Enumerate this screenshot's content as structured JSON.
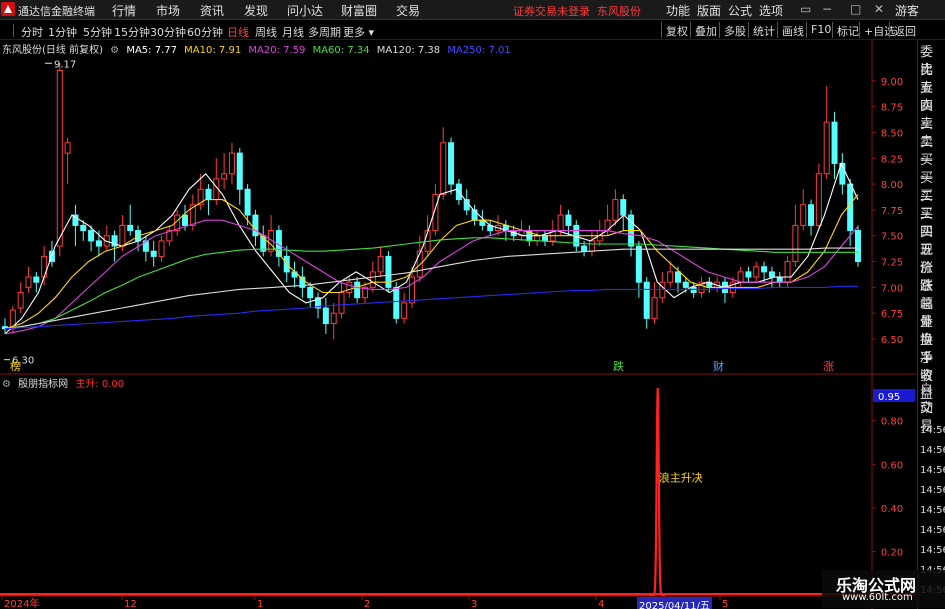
{
  "menubar": {
    "app_title": "通达信金融终端",
    "menus": [
      "行情",
      "市场",
      "资讯",
      "发现",
      "问小达",
      "财富圈",
      "交易"
    ],
    "alert": "证券交易未登录",
    "stock": "东风股份",
    "right_menus": [
      "功能",
      "版面",
      "公式",
      "选项"
    ],
    "guest": "游客"
  },
  "periodbar": {
    "periods": [
      "分时",
      "1分钟",
      "5分钟",
      "15分钟",
      "30分钟",
      "60分钟",
      "日线",
      "周线",
      "月线",
      "多周期",
      "更多"
    ],
    "active": "日线",
    "tools": [
      "复权",
      "叠加",
      "多股",
      "统计",
      "画线",
      "F10",
      "标记",
      "+自选",
      "返回"
    ]
  },
  "header": {
    "stock_name": "东风股份(日线 前复权)",
    "ma": [
      {
        "label": "MA5: 7.77",
        "color": "#ffffff"
      },
      {
        "label": "MA10: 7.91",
        "color": "#ffd700"
      },
      {
        "label": "MA20: 7.59",
        "color": "#e040e0"
      },
      {
        "label": "MA60: 7.34",
        "color": "#40e040"
      },
      {
        "label": "MA120: 7.38",
        "color": "#dddddd"
      },
      {
        "label": "MA250: 7.01",
        "color": "#4040ff"
      }
    ]
  },
  "indicator": {
    "name": "殷朋指标网",
    "series_label": "主升: 0.00",
    "current_value": "0.95",
    "annotation": "浪主升决",
    "y_ticks": [
      "0.80",
      "0.60",
      "0.40",
      "0.20"
    ]
  },
  "price_axis": {
    "ticks": [
      "9.00",
      "8.75",
      "8.50",
      "8.25",
      "8.00",
      "7.75",
      "7.50",
      "7.25",
      "7.00",
      "6.75",
      "6.50"
    ],
    "high_label": "9.17",
    "low_label": "6.30"
  },
  "markers": [
    "榜",
    "跌",
    "财",
    "涨"
  ],
  "time_axis": {
    "labels": [
      "2024年",
      "12",
      "1",
      "2",
      "3",
      "4",
      "5"
    ],
    "cursor_date": "2025/04/11/五"
  },
  "rightpanel": {
    "items": [
      "委比",
      "卖五",
      "卖四",
      "卖三",
      "卖二",
      "卖一",
      "买一",
      "买二",
      "买三",
      "买四",
      "买五",
      "现价",
      "涨跌",
      "涨幅",
      "总量",
      "外盘",
      "换手",
      "净资",
      "收益"
    ],
    "bottom_items": [
      "自动",
      "交易"
    ],
    "times": [
      "14:56",
      "14:56",
      "14:56",
      "14:56",
      "14:56",
      "14:56",
      "14:56",
      "14:56",
      "14:56"
    ]
  },
  "watermark": {
    "title": "乐淘公式网",
    "url": "www.60lt.com"
  },
  "chart_data": {
    "type": "candlestick",
    "ylim": [
      6.3,
      9.17
    ],
    "up_color": "#ff3b3b",
    "down_color": "#54ffff",
    "candles": [
      [
        6.62,
        6.6,
        6.7,
        6.55
      ],
      [
        6.6,
        6.78,
        6.82,
        6.56
      ],
      [
        6.8,
        6.95,
        7.05,
        6.75
      ],
      [
        7.0,
        7.1,
        7.2,
        6.95
      ],
      [
        7.1,
        7.05,
        7.15,
        6.95
      ],
      [
        7.1,
        7.3,
        7.4,
        7.02
      ],
      [
        7.35,
        7.25,
        7.45,
        7.2
      ],
      [
        7.4,
        9.1,
        9.17,
        7.3
      ],
      [
        8.3,
        8.4,
        8.45,
        8.0
      ],
      [
        7.7,
        7.6,
        7.8,
        7.4
      ],
      [
        7.6,
        7.55,
        7.65,
        7.45
      ],
      [
        7.55,
        7.45,
        7.6,
        7.35
      ],
      [
        7.45,
        7.4,
        7.55,
        7.3
      ],
      [
        7.4,
        7.5,
        7.6,
        7.35
      ],
      [
        7.5,
        7.4,
        7.55,
        7.25
      ],
      [
        7.4,
        7.6,
        7.7,
        7.35
      ],
      [
        7.6,
        7.55,
        7.8,
        7.5
      ],
      [
        7.55,
        7.45,
        7.6,
        7.35
      ],
      [
        7.45,
        7.35,
        7.5,
        7.25
      ],
      [
        7.35,
        7.3,
        7.45,
        7.2
      ],
      [
        7.3,
        7.45,
        7.5,
        7.25
      ],
      [
        7.45,
        7.55,
        7.6,
        7.4
      ],
      [
        7.55,
        7.7,
        7.75,
        7.5
      ],
      [
        7.7,
        7.6,
        7.8,
        7.55
      ],
      [
        7.6,
        7.8,
        7.9,
        7.55
      ],
      [
        7.8,
        7.95,
        8.1,
        7.75
      ],
      [
        7.95,
        7.85,
        8.0,
        7.7
      ],
      [
        7.85,
        8.05,
        8.25,
        7.8
      ],
      [
        8.05,
        8.1,
        8.3,
        7.95
      ],
      [
        8.1,
        8.3,
        8.4,
        8.0
      ],
      [
        8.3,
        7.95,
        8.35,
        7.8
      ],
      [
        7.95,
        7.7,
        8.0,
        7.6
      ],
      [
        7.7,
        7.5,
        7.75,
        7.4
      ],
      [
        7.5,
        7.35,
        7.6,
        7.3
      ],
      [
        7.35,
        7.55,
        7.7,
        7.3
      ],
      [
        7.55,
        7.3,
        7.6,
        7.2
      ],
      [
        7.3,
        7.15,
        7.4,
        7.05
      ],
      [
        7.15,
        7.1,
        7.25,
        7.0
      ],
      [
        7.1,
        7.0,
        7.2,
        6.9
      ],
      [
        7.0,
        6.9,
        7.05,
        6.8
      ],
      [
        6.9,
        6.8,
        6.95,
        6.7
      ],
      [
        6.8,
        6.65,
        6.9,
        6.55
      ],
      [
        6.65,
        6.75,
        6.85,
        6.5
      ],
      [
        6.75,
        6.95,
        7.05,
        6.7
      ],
      [
        6.95,
        7.05,
        7.1,
        6.9
      ],
      [
        7.05,
        6.9,
        7.1,
        6.85
      ],
      [
        6.9,
        7.0,
        7.05,
        6.85
      ],
      [
        7.0,
        7.15,
        7.25,
        6.95
      ],
      [
        7.15,
        7.3,
        7.4,
        7.1
      ],
      [
        7.3,
        7.0,
        7.35,
        6.95
      ],
      [
        7.0,
        6.7,
        7.05,
        6.65
      ],
      [
        6.7,
        6.85,
        6.95,
        6.65
      ],
      [
        6.85,
        7.1,
        7.2,
        6.8
      ],
      [
        7.1,
        7.35,
        7.5,
        7.05
      ],
      [
        7.35,
        7.55,
        7.7,
        7.3
      ],
      [
        7.55,
        7.9,
        8.0,
        7.5
      ],
      [
        7.9,
        8.4,
        8.55,
        7.85
      ],
      [
        8.4,
        8.0,
        8.45,
        7.9
      ],
      [
        8.0,
        7.85,
        8.05,
        7.8
      ],
      [
        7.85,
        7.75,
        7.95,
        7.7
      ],
      [
        7.75,
        7.65,
        7.8,
        7.6
      ],
      [
        7.65,
        7.6,
        7.75,
        7.55
      ],
      [
        7.6,
        7.55,
        7.65,
        7.5
      ],
      [
        7.55,
        7.6,
        7.7,
        7.5
      ],
      [
        7.6,
        7.55,
        7.65,
        7.45
      ],
      [
        7.55,
        7.5,
        7.6,
        7.45
      ],
      [
        7.5,
        7.55,
        7.65,
        7.45
      ],
      [
        7.55,
        7.45,
        7.6,
        7.4
      ],
      [
        7.45,
        7.5,
        7.55,
        7.4
      ],
      [
        7.5,
        7.45,
        7.55,
        7.4
      ],
      [
        7.45,
        7.55,
        7.65,
        7.4
      ],
      [
        7.55,
        7.7,
        7.8,
        7.5
      ],
      [
        7.7,
        7.6,
        7.75,
        7.5
      ],
      [
        7.6,
        7.4,
        7.65,
        7.35
      ],
      [
        7.4,
        7.35,
        7.45,
        7.3
      ],
      [
        7.35,
        7.45,
        7.55,
        7.3
      ],
      [
        7.45,
        7.55,
        7.65,
        7.4
      ],
      [
        7.55,
        7.65,
        7.8,
        7.5
      ],
      [
        7.65,
        7.85,
        7.95,
        7.6
      ],
      [
        7.85,
        7.7,
        7.9,
        7.55
      ],
      [
        7.7,
        7.4,
        7.75,
        7.3
      ],
      [
        7.4,
        7.05,
        7.45,
        6.9
      ],
      [
        7.05,
        6.7,
        7.1,
        6.6
      ],
      [
        6.7,
        6.9,
        7.05,
        6.65
      ],
      [
        6.9,
        7.05,
        7.15,
        6.85
      ],
      [
        7.05,
        7.15,
        7.25,
        7.0
      ],
      [
        7.15,
        7.05,
        7.2,
        6.95
      ],
      [
        7.05,
        7.0,
        7.1,
        6.95
      ],
      [
        7.0,
        6.95,
        7.05,
        6.9
      ],
      [
        6.95,
        7.05,
        7.1,
        6.9
      ],
      [
        7.05,
        7.0,
        7.1,
        6.95
      ],
      [
        7.0,
        7.05,
        7.1,
        6.95
      ],
      [
        7.05,
        6.95,
        7.1,
        6.85
      ],
      [
        6.95,
        7.05,
        7.1,
        6.9
      ],
      [
        7.05,
        7.15,
        7.2,
        7.0
      ],
      [
        7.15,
        7.1,
        7.2,
        7.05
      ],
      [
        7.1,
        7.2,
        7.25,
        7.05
      ],
      [
        7.2,
        7.15,
        7.25,
        7.05
      ],
      [
        7.15,
        7.1,
        7.2,
        7.0
      ],
      [
        7.1,
        7.05,
        7.15,
        7.0
      ],
      [
        7.05,
        7.25,
        7.3,
        7.0
      ],
      [
        7.25,
        7.6,
        7.8,
        7.2
      ],
      [
        7.6,
        7.8,
        7.95,
        7.55
      ],
      [
        7.8,
        7.6,
        7.85,
        7.5
      ],
      [
        7.6,
        8.1,
        8.2,
        7.55
      ],
      [
        8.1,
        8.6,
        8.95,
        8.05
      ],
      [
        8.6,
        8.2,
        8.7,
        8.05
      ],
      [
        8.2,
        8.0,
        8.3,
        7.9
      ],
      [
        8.0,
        7.55,
        8.05,
        7.4
      ],
      [
        7.55,
        7.25,
        7.6,
        7.2
      ]
    ],
    "ma_series": [
      {
        "name": "MA5",
        "color": "#ffffff",
        "values": [
          6.55,
          6.7,
          6.95,
          7.4,
          7.7,
          7.6,
          7.45,
          7.4,
          7.45,
          7.55,
          7.7,
          7.95,
          8.1,
          7.9,
          7.6,
          7.35,
          7.15,
          6.95,
          6.85,
          6.9,
          7.05,
          7.15,
          7.05,
          6.95,
          7.05,
          7.4,
          7.9,
          7.95,
          7.75,
          7.6,
          7.55,
          7.5,
          7.5,
          7.55,
          7.5,
          7.45,
          7.55,
          7.7,
          7.55,
          7.05,
          6.9,
          7.0,
          7.05,
          7.0,
          7.05,
          7.05,
          7.1,
          7.1,
          7.3,
          7.7,
          8.2,
          7.85
        ]
      },
      {
        "name": "MA10",
        "color": "#ffd700",
        "values": [
          6.6,
          6.65,
          6.75,
          6.9,
          7.1,
          7.25,
          7.35,
          7.4,
          7.5,
          7.55,
          7.6,
          7.75,
          7.85,
          7.85,
          7.75,
          7.55,
          7.4,
          7.2,
          7.05,
          6.95,
          6.95,
          7.0,
          7.05,
          7.05,
          7.1,
          7.25,
          7.45,
          7.6,
          7.65,
          7.65,
          7.6,
          7.55,
          7.5,
          7.5,
          7.5,
          7.5,
          7.5,
          7.55,
          7.55,
          7.35,
          7.2,
          7.05,
          7.0,
          7.0,
          7.0,
          7.0,
          7.05,
          7.05,
          7.15,
          7.35,
          7.7,
          7.9
        ]
      },
      {
        "name": "MA20",
        "color": "#e040e0",
        "values": [
          6.55,
          6.58,
          6.62,
          6.7,
          6.85,
          7.0,
          7.15,
          7.3,
          7.4,
          7.5,
          7.55,
          7.6,
          7.65,
          7.65,
          7.6,
          7.55,
          7.45,
          7.35,
          7.25,
          7.15,
          7.05,
          7.0,
          6.98,
          6.98,
          7.0,
          7.1,
          7.25,
          7.35,
          7.45,
          7.5,
          7.55,
          7.55,
          7.55,
          7.55,
          7.55,
          7.55,
          7.55,
          7.52,
          7.5,
          7.45,
          7.35,
          7.25,
          7.15,
          7.1,
          7.05,
          7.05,
          7.05,
          7.05,
          7.1,
          7.2,
          7.4,
          7.59
        ]
      },
      {
        "name": "MA60",
        "color": "#40e040",
        "values": [
          6.6,
          6.62,
          6.65,
          6.7,
          6.78,
          6.86,
          6.95,
          7.02,
          7.1,
          7.16,
          7.22,
          7.28,
          7.32,
          7.34,
          7.36,
          7.37,
          7.37,
          7.36,
          7.35,
          7.35,
          7.36,
          7.37,
          7.38,
          7.4,
          7.42,
          7.44,
          7.46,
          7.47,
          7.48,
          7.48,
          7.47,
          7.46,
          7.45,
          7.44,
          7.43,
          7.42,
          7.42,
          7.42,
          7.42,
          7.41,
          7.4,
          7.39,
          7.38,
          7.37,
          7.36,
          7.35,
          7.34,
          7.34,
          7.34,
          7.34,
          7.34,
          7.34
        ]
      },
      {
        "name": "MA120",
        "color": "#dddddd",
        "values": [
          6.6,
          6.62,
          6.65,
          6.68,
          6.71,
          6.74,
          6.77,
          6.8,
          6.83,
          6.86,
          6.89,
          6.92,
          6.94,
          6.96,
          6.98,
          6.99,
          7.0,
          7.01,
          7.02,
          7.04,
          7.06,
          7.08,
          7.1,
          7.12,
          7.14,
          7.17,
          7.2,
          7.23,
          7.26,
          7.28,
          7.3,
          7.31,
          7.32,
          7.33,
          7.34,
          7.35,
          7.36,
          7.37,
          7.37,
          7.37,
          7.37,
          7.37,
          7.37,
          7.37,
          7.37,
          7.37,
          7.37,
          7.37,
          7.37,
          7.38,
          7.38,
          7.38
        ]
      },
      {
        "name": "MA250",
        "color": "#2a2af0",
        "values": [
          6.6,
          6.61,
          6.62,
          6.63,
          6.64,
          6.65,
          6.66,
          6.67,
          6.68,
          6.69,
          6.7,
          6.72,
          6.73,
          6.74,
          6.75,
          6.77,
          6.78,
          6.79,
          6.8,
          6.82,
          6.83,
          6.84,
          6.85,
          6.86,
          6.87,
          6.88,
          6.89,
          6.9,
          6.91,
          6.92,
          6.93,
          6.94,
          6.95,
          6.96,
          6.97,
          6.97,
          6.98,
          6.98,
          6.98,
          6.98,
          6.98,
          6.98,
          6.98,
          6.99,
          6.99,
          6.99,
          7.0,
          7.0,
          7.0,
          7.0,
          7.01,
          7.01
        ]
      }
    ],
    "indicator_series": {
      "name": "主升",
      "ylim": [
        0,
        0.95
      ],
      "peak_index": 82,
      "peak_value": 0.95
    }
  }
}
